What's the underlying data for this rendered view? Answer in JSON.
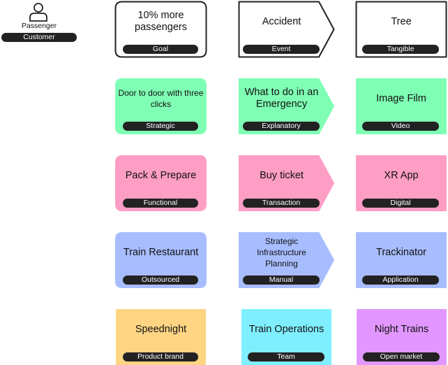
{
  "actor": {
    "label": "Passenger",
    "tag": "Customer"
  },
  "rows": [
    [
      {
        "title": "10% more passengers",
        "tag": "Goal",
        "fill": "#ffffff",
        "shape": "round-outline"
      },
      {
        "title": "Accident",
        "tag": "Event",
        "fill": "#ffffff",
        "shape": "arrow-outline"
      },
      {
        "title": "Tree",
        "tag": "Tangible",
        "fill": "#ffffff",
        "shape": "rect-outline"
      }
    ],
    [
      {
        "title": "Door to door with three clicks",
        "tag": "Strategic",
        "fill": "#7fffb4",
        "shape": "round"
      },
      {
        "title": "What to do in an Emergency",
        "tag": "Explanatory",
        "fill": "#7fffb4",
        "shape": "arrow"
      },
      {
        "title": "Image Film",
        "tag": "Video",
        "fill": "#7fffb4",
        "shape": "rect"
      }
    ],
    [
      {
        "title": "Pack & Prepare",
        "tag": "Functional",
        "fill": "#ff9ec4",
        "shape": "round"
      },
      {
        "title": "Buy ticket",
        "tag": "Transaction",
        "fill": "#ff9ec4",
        "shape": "arrow"
      },
      {
        "title": "XR App",
        "tag": "Digital",
        "fill": "#ff9ec4",
        "shape": "rect"
      }
    ],
    [
      {
        "title": "Train Restaurant",
        "tag": "Outsourced",
        "fill": "#a7bdff",
        "shape": "round"
      },
      {
        "title": "Strategic Infrastructure Planning",
        "tag": "Manual",
        "fill": "#a7bdff",
        "shape": "arrow"
      },
      {
        "title": "Trackinator",
        "tag": "Application",
        "fill": "#a7bdff",
        "shape": "rect"
      }
    ],
    [
      {
        "title": "Speednight",
        "tag": "Product brand",
        "fill": "#ffd584",
        "shape": "rect"
      },
      {
        "title": "Train Operations",
        "tag": "Team",
        "fill": "#7fefff",
        "shape": "rect"
      },
      {
        "title": "Night Trains",
        "tag": "Open market",
        "fill": "#e197ff",
        "shape": "rect"
      }
    ]
  ]
}
